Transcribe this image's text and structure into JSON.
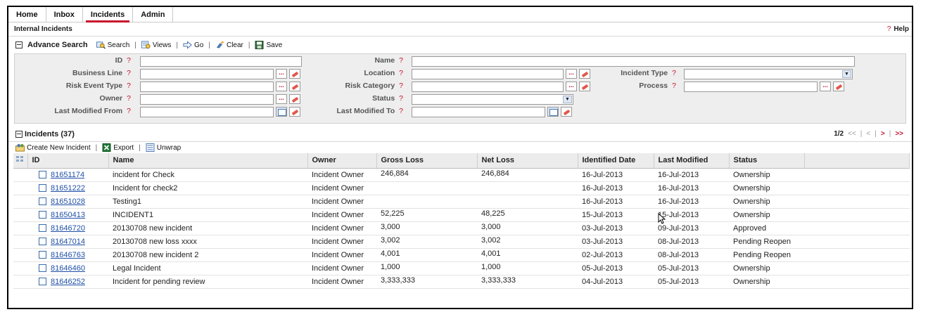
{
  "tabs": [
    {
      "label": "Home"
    },
    {
      "label": "Inbox"
    },
    {
      "label": "Incidents",
      "active": true
    },
    {
      "label": "Admin"
    }
  ],
  "page": {
    "title": "Internal Incidents",
    "help": "Help"
  },
  "search": {
    "title": "Advance Search",
    "actions": {
      "search": "Search",
      "views": "Views",
      "go": "Go",
      "clear": "Clear",
      "save": "Save"
    },
    "fields": {
      "id": "ID",
      "name": "Name",
      "business_line": "Business Line",
      "location": "Location",
      "incident_type": "Incident Type",
      "risk_event_type": "Risk Event Type",
      "risk_category": "Risk Category",
      "process": "Process",
      "owner": "Owner",
      "status": "Status",
      "last_modified_from": "Last Modified From",
      "last_modified_to": "Last Modified To"
    },
    "help_mark": "?",
    "dots": "..."
  },
  "incidents": {
    "title": "Incidents (37)",
    "pager": {
      "page": "1/2",
      "first": "<<",
      "prev": "<",
      "next": ">",
      "last": ">>"
    },
    "toolbar": {
      "create": "Create New Incident",
      "export": "Export",
      "unwrap": "Unwrap"
    },
    "columns": [
      "ID",
      "Name",
      "Owner",
      "Gross Loss",
      "Net Loss",
      "Identified Date",
      "Last Modified",
      "Status"
    ],
    "rows": [
      {
        "id": "81651174",
        "name": "incident for Check",
        "owner": "Incident Owner",
        "gross": "246,884",
        "net": "246,884",
        "identified": "16-Jul-2013",
        "modified": "16-Jul-2013",
        "status": "Ownership"
      },
      {
        "id": "81651222",
        "name": "Incident for check2",
        "owner": "Incident Owner",
        "gross": "",
        "net": "",
        "identified": "16-Jul-2013",
        "modified": "16-Jul-2013",
        "status": "Ownership"
      },
      {
        "id": "81651028",
        "name": "Testing1",
        "owner": "Incident Owner",
        "gross": "",
        "net": "",
        "identified": "16-Jul-2013",
        "modified": "16-Jul-2013",
        "status": "Ownership"
      },
      {
        "id": "81650413",
        "name": "INCIDENT1",
        "owner": "Incident Owner",
        "gross": "52,225",
        "net": "48,225",
        "identified": "15-Jul-2013",
        "modified": "15-Jul-2013",
        "status": "Ownership"
      },
      {
        "id": "81646720",
        "name": "20130708 new incident",
        "owner": "Incident Owner",
        "gross": "3,000",
        "net": "3,000",
        "identified": "03-Jul-2013",
        "modified": "09-Jul-2013",
        "status": "Approved"
      },
      {
        "id": "81647014",
        "name": "20130708 new loss xxxx",
        "owner": "Incident Owner",
        "gross": "3,002",
        "net": "3,002",
        "identified": "03-Jul-2013",
        "modified": "08-Jul-2013",
        "status": "Pending Reopen"
      },
      {
        "id": "81646763",
        "name": "20130708 new incident 2",
        "owner": "Incident Owner",
        "gross": "4,001",
        "net": "4,001",
        "identified": "02-Jul-2013",
        "modified": "08-Jul-2013",
        "status": "Pending Reopen"
      },
      {
        "id": "81646460",
        "name": "Legal Incident",
        "owner": "Incident Owner",
        "gross": "1,000",
        "net": "1,000",
        "identified": "05-Jul-2013",
        "modified": "05-Jul-2013",
        "status": "Ownership"
      },
      {
        "id": "81646252",
        "name": "Incident for pending review",
        "owner": "Incident Owner",
        "gross": "3,333,333",
        "net": "3,333,333",
        "identified": "04-Jul-2013",
        "modified": "05-Jul-2013",
        "status": "Ownership"
      }
    ]
  },
  "colors": {
    "accent": "#c8102e",
    "link": "#1f4fa8",
    "panel": "#eeeeee",
    "header": "#ececec"
  },
  "icons": [
    "collapse-icon",
    "search-icon",
    "views-icon",
    "go-icon",
    "clear-icon",
    "save-icon",
    "create-incident-icon",
    "export-icon",
    "unwrap-icon",
    "cal-icon",
    "erase-icon",
    "grid-config-icon",
    "mouse-cursor-icon"
  ]
}
